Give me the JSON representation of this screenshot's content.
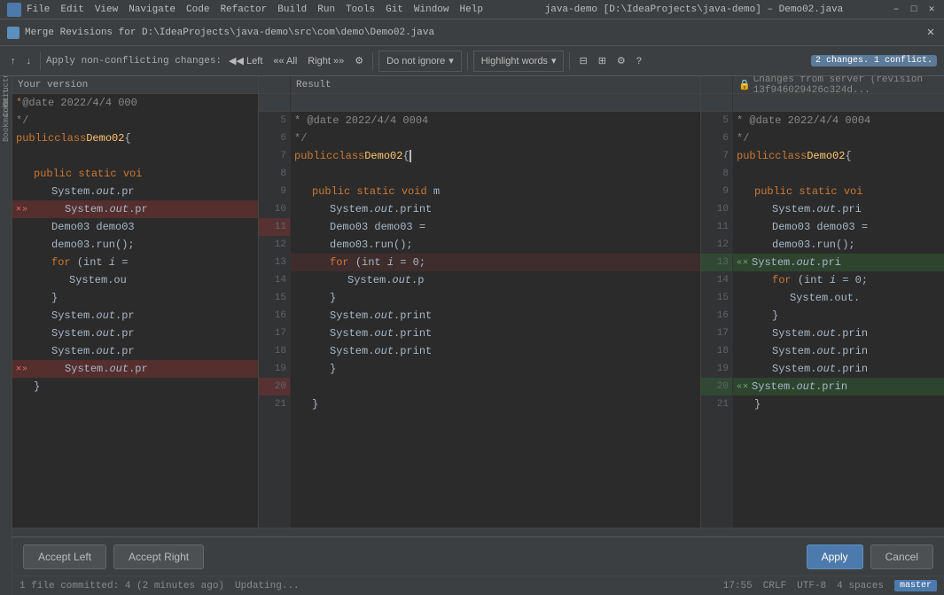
{
  "titleBar": {
    "menus": [
      "File",
      "Edit",
      "View",
      "Navigate",
      "Code",
      "Refactor",
      "Build",
      "Run",
      "Tools",
      "Git",
      "Window",
      "Help"
    ],
    "title": "java-demo [D:\\IdeaProjects\\java-demo] – Demo02.java",
    "controls": [
      "–",
      "□",
      "✕"
    ]
  },
  "mergeBar": {
    "title": "Merge Revisions for D:\\IdeaProjects\\java-demo\\src\\com\\demo\\Demo02.java",
    "closeLabel": "✕"
  },
  "actionBar": {
    "upArrowLabel": "↑",
    "downArrowLabel": "↓",
    "applyNonConflictLabel": "Apply non-conflicting changes:",
    "leftLabel": "◀◀ Left",
    "allLabel": "«« All",
    "rightLabel": "Right »»",
    "settingsLabel": "⚙",
    "doNotIgnoreLabel": "Do not ignore",
    "dropdownArrow": "▾",
    "highlightWords": "Highlight words",
    "layoutIcon": "⊟",
    "columnsIcon": "⊞",
    "gearIcon": "⚙",
    "helpIcon": "?",
    "badge": "2 changes. 1 conflict."
  },
  "panels": {
    "left": {
      "header": "Your version"
    },
    "middle": {
      "header": "Result"
    },
    "right": {
      "header": "🔒 Changes from server (revision 13f946029426c324d..."
    }
  },
  "lines": {
    "lineNumbers": [
      5,
      6,
      7,
      8,
      9,
      10,
      11,
      12,
      13,
      14,
      15,
      16,
      17,
      18,
      19,
      20,
      21
    ],
    "leftCode": [
      "* @date 2022/4/4 000",
      "*/",
      "public class Demo02 {",
      "",
      "    public static voi",
      "        System.out.pr",
      "        System.out.pr",
      "        Demo03 demo03",
      "        demo03.run();",
      "        for (int i =",
      "            System.ou",
      "        }",
      "        System.out.pr",
      "        System.out.pr",
      "        System.out.pr",
      "        System.out.pr",
      "    }"
    ],
    "middleCode": [
      "* @date 2022/4/4 0004",
      "*/",
      "public class Demo02 { _",
      "",
      "    public static void m",
      "        System.out.print",
      "        Demo03 demo03 =",
      "        demo03.run();",
      "        for (int i = 0;",
      "            System.out.p",
      "        }",
      "        System.out.print",
      "        System.out.print",
      "        System.out.print",
      "        }",
      "",
      "        System.out.print",
      "        System.out.print",
      "        }",
      "",
      "    }"
    ],
    "rightCode": [
      "* @date 2022/4/4 0004",
      "*/",
      "public class Demo02 {",
      "",
      "    public static voi",
      "        System.out.pri",
      "        Demo03 demo03 =",
      "        demo03.run();",
      "        System.out.pri",
      "        for (int i = 0;",
      "            System.out.",
      "        }",
      "        System.out.prin",
      "        System.out.prin",
      "        System.out.prin",
      "        System.out.prin",
      "    }"
    ]
  },
  "buttons": {
    "acceptLeft": "Accept Left",
    "acceptRight": "Accept Right",
    "apply": "Apply",
    "cancel": "Cancel"
  },
  "statusBar": {
    "committed": "1 file committed: 4 (2 minutes ago)",
    "updating": "Updating...",
    "time": "17:55",
    "encoding": "CRLF",
    "charset": "UTF-8",
    "indent": "4 spaces",
    "branch": "master"
  },
  "sidebarItems": [
    "Structure",
    "Commit",
    "Bookmarks"
  ]
}
